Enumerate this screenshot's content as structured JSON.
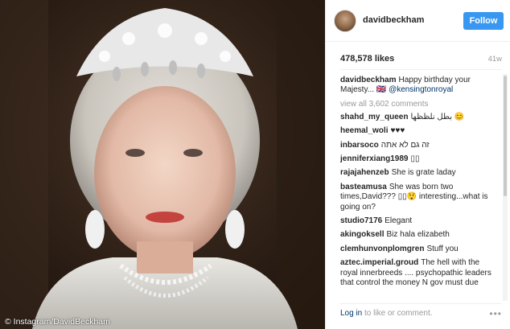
{
  "photo": {
    "watermark": "© Instagram/DavidBeckham"
  },
  "header": {
    "username": "davidbeckham",
    "follow_label": "Follow"
  },
  "stats": {
    "likes": "478,578 likes",
    "age": "41w"
  },
  "caption": {
    "user": "davidbeckham",
    "text": "Happy birthday your Majesty... 🇬🇧 ",
    "mention": "@kensingtonroyal"
  },
  "view_all": "view all 3,602 comments",
  "comments": [
    {
      "user": "shahd_my_queen",
      "text": "بطل نلظظها 😊"
    },
    {
      "user": "heemal_woli",
      "text": "♥♥♥"
    },
    {
      "user": "inbarsoco",
      "text": "זה גם לא אתה"
    },
    {
      "user": "jenniferxiang1989",
      "text": "▯▯"
    },
    {
      "user": "rajajahenzeb",
      "text": "She is grate laday"
    },
    {
      "user": "basteamusa",
      "text": "She was born two times,David??? ▯▯😲 interesting...what is going on?"
    },
    {
      "user": "studio7176",
      "text": "Elegant"
    },
    {
      "user": "akingoksell",
      "text": "Biz hala elizabeth"
    },
    {
      "user": "clemhunvonplomgren",
      "text": "Stuff you"
    },
    {
      "user": "aztec.imperial.groud",
      "text": "The hell with the royal innerbreeds .... psychopathic leaders that control the money N gov must due"
    }
  ],
  "footer": {
    "login_link": "Log in",
    "login_rest": " to like or comment.",
    "more_icon": "ellipsis-icon"
  }
}
